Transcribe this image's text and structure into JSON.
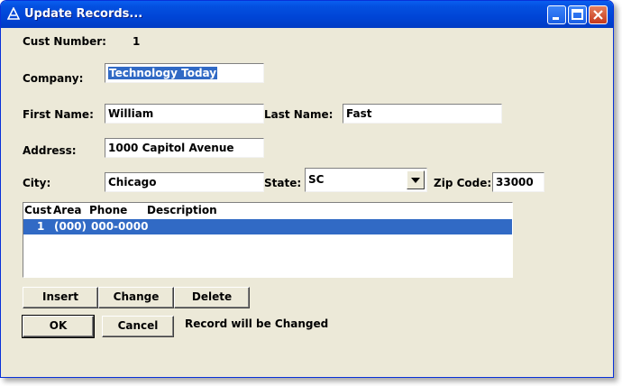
{
  "window": {
    "title": "Update Records..."
  },
  "fields": {
    "cust_number_label": "Cust Number:",
    "cust_number_value": "1",
    "company_label": "Company:",
    "company_value": "Technology Today",
    "first_name_label": "First Name:",
    "first_name_value": "William",
    "last_name_label": "Last Name:",
    "last_name_value": "Fast",
    "address_label": "Address:",
    "address_value": "1000 Capitol Avenue",
    "city_label": "City:",
    "city_value": "Chicago",
    "state_label": "State:",
    "state_value": "SC",
    "zip_label": "Zip Code:",
    "zip_value": "33000"
  },
  "phones": {
    "columns": [
      "Cust",
      "Area",
      "Phone",
      "Description"
    ],
    "rows": [
      {
        "cust": "1",
        "area": "(000)",
        "phone": "000-0000",
        "description": ""
      }
    ]
  },
  "buttons": {
    "insert": "Insert",
    "change": "Change",
    "delete": "Delete",
    "ok": "OK",
    "cancel": "Cancel"
  },
  "status": "Record will be Changed",
  "colors": {
    "titlebar": "#0450e0",
    "dialog": "#ece9d8",
    "selection": "#316ac5"
  },
  "icons": {
    "app": "app-triangle-icon",
    "minimize": "minimize-icon",
    "maximize": "maximize-icon",
    "close": "close-icon"
  }
}
